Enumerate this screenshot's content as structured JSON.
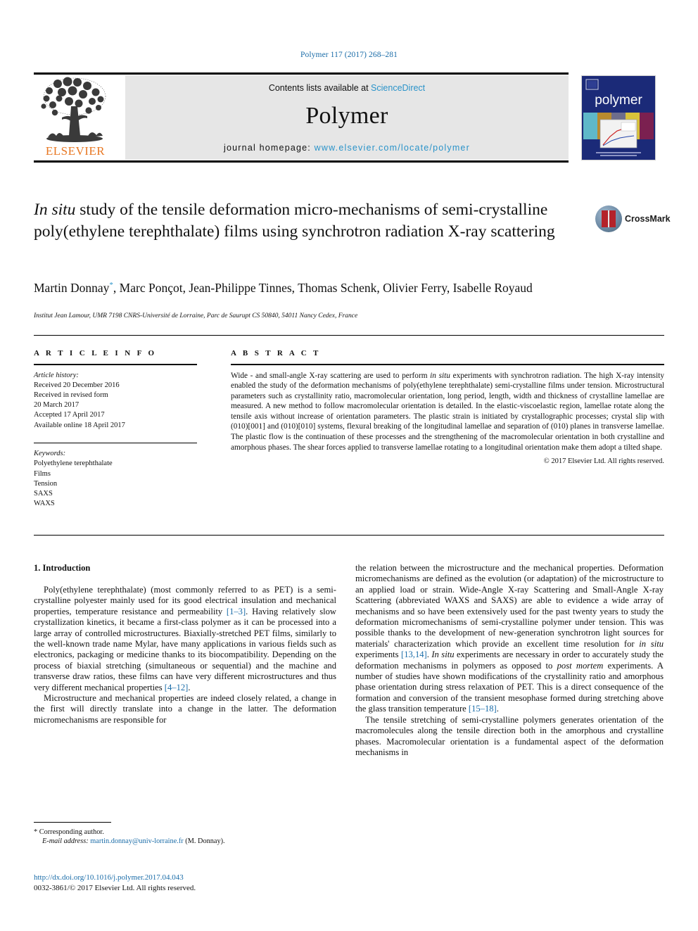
{
  "running_head": "Polymer 117 (2017) 268–281",
  "masthead": {
    "contents_prefix": "Contents lists available at ",
    "contents_link": "ScienceDirect",
    "journal_name": "Polymer",
    "homepage_prefix": "journal homepage: ",
    "homepage_url": "www.elsevier.com/locate/polymer",
    "publisher_logo_text": "ELSEVIER",
    "cover_title": "polymer"
  },
  "crossmark": {
    "label": "CrossMark"
  },
  "article": {
    "title_line1_italic": "In situ",
    "title_line1_rest": " study of the tensile deformation micro-mechanisms of",
    "title_line2": "semi-crystalline poly(ethylene terephthalate) films using",
    "title_line3": "synchrotron radiation X-ray scattering",
    "authors": "Martin Donnay*, Marc Ponçot, Jean-Philippe Tinnes, Thomas Schenk, Olivier Ferry, Isabelle Royaud",
    "authors_before_star": "Martin Donnay",
    "author_star": "*",
    "authors_after_star": ", Marc Ponçot, Jean-Philippe Tinnes, Thomas Schenk, Olivier Ferry, Isabelle Royaud",
    "affiliation": "Institut Jean Lamour, UMR 7198 CNRS-Université de Lorraine, Parc de Saurupt CS 50840, 54011 Nancy Cedex, France"
  },
  "article_info": {
    "heading": "A R T I C L E   I N F O",
    "history_label": "Article history:",
    "history": [
      "Received 20 December 2016",
      "Received in revised form",
      "20 March 2017",
      "Accepted 17 April 2017",
      "Available online 18 April 2017"
    ],
    "keywords_label": "Keywords:",
    "keywords": [
      "Polyethylene terephthalate",
      "Films",
      "Tension",
      "SAXS",
      "WAXS"
    ]
  },
  "abstract": {
    "heading": "A B S T R A C T",
    "p1_a": "Wide - and small-angle X-ray scattering are used to perform ",
    "p1_em": "in situ",
    "p1_b": " experiments with synchrotron radiation. The high X-ray intensity enabled the study of the deformation mechanisms of poly(ethylene terephthalate) semi-crystalline films under tension. Microstructural parameters such as crystallinity ratio, macromolecular orientation, long period, length, width and thickness of crystalline lamellae are measured. A new method to follow macromolecular orientation is detailed. In the elastic-viscoelastic region, lamellae rotate along the tensile axis without increase of orientation parameters. The plastic strain is initiated by crystallographic processes; crystal slip with (010)[001] and (010)[010] systems, flexural breaking of the longitudinal lamellae and separation of (010) planes in transverse lamellae. The plastic flow is the continuation of these processes and the strengthening of the macromolecular orientation in both crystalline and amorphous phases. The shear forces applied to transverse lamellae rotating to a longitudinal orientation make them adopt a tilted shape.",
    "copyright": "© 2017 Elsevier Ltd. All rights reserved."
  },
  "body": {
    "section_number_title": "1. Introduction",
    "left_p1_a": "Poly(ethylene terephthalate) (most commonly referred to as PET) is a semi-crystalline polyester mainly used for its good electrical insulation and mechanical properties, temperature resistance and permeability ",
    "left_p1_ref1": "[1–3]",
    "left_p1_b": ". Having relatively slow crystallization kinetics, it became a first-class polymer as it can be processed into a large array of controlled microstructures. Biaxially-stretched PET films, similarly to the well-known trade name Mylar, have many applications in various fields such as electronics, packaging or medicine thanks to its biocompatibility. Depending on the process of biaxial stretching (simultaneous or sequential) and the machine and transverse draw ratios, these films can have very different microstructures and thus very different mechanical properties ",
    "left_p1_ref2": "[4–12]",
    "left_p1_c": ".",
    "left_p2": "Microstructure and mechanical properties are indeed closely related, a change in the first will directly translate into a change in the latter. The deformation micromechanisms are responsible for",
    "right_p1_a": "the relation between the microstructure and the mechanical properties. Deformation micromechanisms are defined as the evolution (or adaptation) of the microstructure to an applied load or strain. Wide-Angle X-ray Scattering and Small-Angle X-ray Scattering (abbreviated WAXS and SAXS) are able to evidence a wide array of mechanisms and so have been extensively used for the past twenty years to study the deformation micromechanisms of semi-crystalline polymer under tension. This was possible thanks to the development of new-generation synchrotron light sources for materials' characterization which provide an excellent time resolution for ",
    "right_p1_em1": "in situ",
    "right_p1_b": " experiments ",
    "right_p1_ref1": "[13,14]",
    "right_p1_c": ". ",
    "right_p1_em2": "In situ",
    "right_p1_d": " experiments are necessary in order to accurately study the deformation mechanisms in polymers as opposed to ",
    "right_p1_em3": "post mortem",
    "right_p1_e": " experiments. A number of studies have shown modifications of the crystallinity ratio and amorphous phase orientation during stress relaxation of PET. This is a direct consequence of the formation and conversion of the transient mesophase formed during stretching above the glass transition temperature ",
    "right_p1_ref2": "[15–18]",
    "right_p1_f": ".",
    "right_p2": "The tensile stretching of semi-crystalline polymers generates orientation of the macromolecules along the tensile direction both in the amorphous and crystalline phases. Macromolecular orientation is a fundamental aspect of the deformation mechanisms in"
  },
  "footer": {
    "corresponding_star": "*",
    "corresponding_label": " Corresponding author.",
    "email_label": "E-mail address:",
    "email": "martin.donnay@univ-lorraine.fr",
    "email_suffix": " (M. Donnay).",
    "doi_url": "http://dx.doi.org/10.1016/j.polymer.2017.04.043",
    "issn_line": "0032-3861/© 2017 Elsevier Ltd. All rights reserved."
  },
  "colors": {
    "link_blue": "#1a6ca8",
    "sciencedirect_blue": "#2a93c9",
    "elsevier_orange": "#e87722",
    "cover_navy": "#1a2a7a"
  }
}
